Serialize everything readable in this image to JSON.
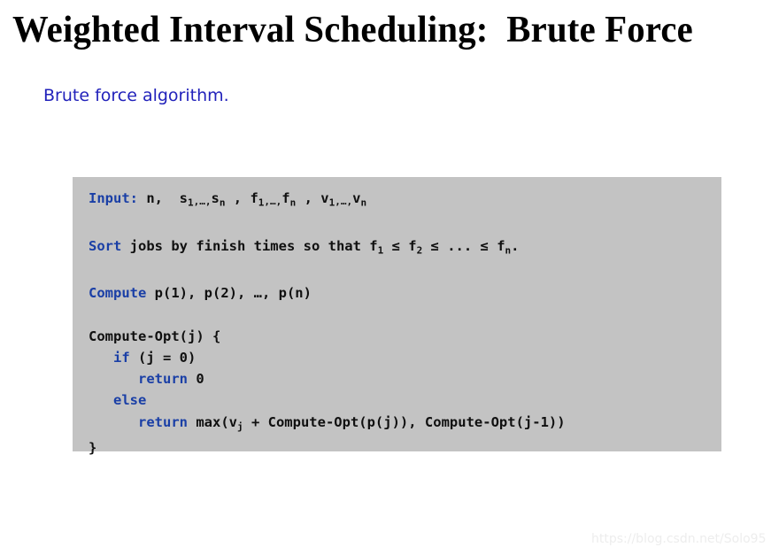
{
  "slide": {
    "background_color": "#FFFFFF",
    "title": "Weighted Interval Scheduling:  Brute Force",
    "bullet": "Brute force algorithm.",
    "bullet_color": "#2222BB",
    "watermark": "https://blog.csdn.net/Solo95"
  },
  "code_block": {
    "background_color": "#C3C3C3",
    "keyword_color": "#1A3FA6",
    "text_color": "#101010",
    "lines": [
      {
        "id": "line-input",
        "keyword": "Input:",
        "rest": " n,  s",
        "plain_text": "Input: n,  s1,…,sn , f1,…,fn , v1,…,vn"
      },
      {
        "id": "line-blank-1",
        "plain_text": ""
      },
      {
        "id": "line-sort",
        "keyword": "Sort",
        "rest": " jobs by finish times so that f",
        "plain_text": "Sort jobs by finish times so that f1 ≤ f2 ≤ ... ≤ fn."
      },
      {
        "id": "line-blank-2",
        "plain_text": ""
      },
      {
        "id": "line-compute-p",
        "keyword": "Compute",
        "rest": " p(1), p(2), …, p(n)",
        "plain_text": "Compute p(1), p(2), …, p(n)"
      },
      {
        "id": "line-blank-3",
        "plain_text": ""
      },
      {
        "id": "line-func-open",
        "plain_text": "Compute-Opt(j) {"
      },
      {
        "id": "line-if",
        "keyword": "if",
        "rest": " (j = 0)",
        "plain_text": "   if (j = 0)"
      },
      {
        "id": "line-return-zero",
        "keyword": "return",
        "rest": " 0",
        "plain_text": "      return 0"
      },
      {
        "id": "line-else",
        "keyword": "else",
        "rest": "",
        "plain_text": "   else"
      },
      {
        "id": "line-return-max",
        "keyword": "return",
        "rest": " max(v",
        "plain_text": "      return max(vj + Compute-Opt(p(j)), Compute-Opt(j-1))"
      },
      {
        "id": "line-func-close",
        "plain_text": "}"
      }
    ],
    "tokens": {
      "input_kw": "Input:",
      "input_a": " n,  s",
      "input_sub_1": "1",
      "input_ell_1": ",…,",
      "input_b": "s",
      "input_sub_n1": "n",
      "input_c": " , f",
      "input_sub_2": "1",
      "input_ell_2": ",…,",
      "input_d": "f",
      "input_sub_n2": "n",
      "input_e": " , v",
      "input_sub_3": "1",
      "input_ell_3": ",…,",
      "input_f": "v",
      "input_sub_n3": "n",
      "sort_kw": "Sort",
      "sort_a": " jobs by finish times so that f",
      "sort_sub_1": "1",
      "sort_b": " ≤ f",
      "sort_sub_2": "2",
      "sort_c": " ≤ ... ≤ f",
      "sort_sub_n": "n",
      "sort_d": ".",
      "compute_kw": "Compute",
      "compute_a": " p(1), p(2), …, p(n)",
      "func_open": "Compute-Opt(j) {",
      "if_indent": "   ",
      "if_kw": "if",
      "if_a": " (j = 0)",
      "ret0_indent": "      ",
      "ret0_kw": "return",
      "ret0_a": " 0",
      "else_indent": "   ",
      "else_kw": "else",
      "retmax_indent": "      ",
      "retmax_kw": "return",
      "retmax_a": " max(v",
      "retmax_sub_j": "j",
      "retmax_b": " + Compute-Opt(p(j)), Compute-Opt(j-1))",
      "func_close": "}"
    }
  }
}
